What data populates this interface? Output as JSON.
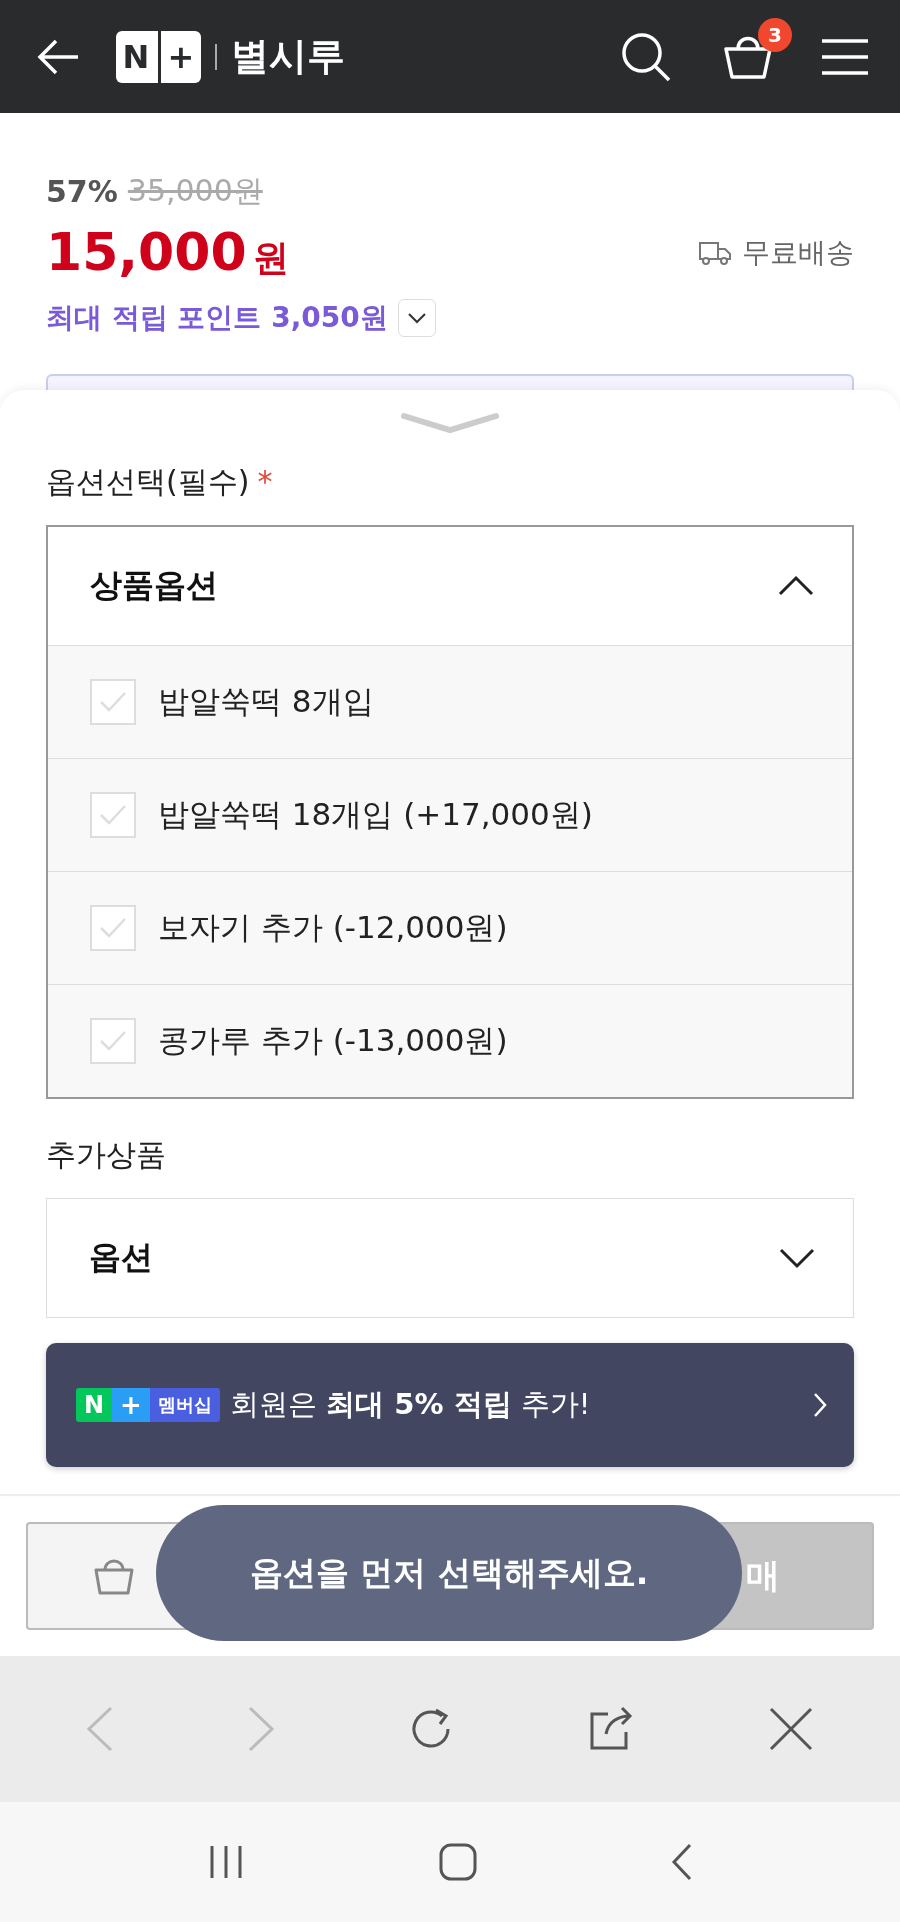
{
  "header": {
    "logo": {
      "n": "N",
      "plus": "+"
    },
    "store_name": "별시루",
    "cart_count": "3"
  },
  "price": {
    "discount": "57%",
    "original": "35,000원",
    "amount": "15,000",
    "currency": "원",
    "shipping": "무료배송",
    "points": "최대 적립 포인트 3,050원",
    "points_expanded": false
  },
  "option_sheet": {
    "label": "옵션선택(필수)",
    "required_mark": "*",
    "dropdown": {
      "title": "상품옵션",
      "expanded": true,
      "options": [
        {
          "label": "밥알쑥떡 8개입",
          "checked": false
        },
        {
          "label": "밥알쑥떡 18개입 (+17,000원)",
          "checked": false
        },
        {
          "label": "보자기 추가 (-12,000원)",
          "checked": false
        },
        {
          "label": "콩가루 추가 (-13,000원)",
          "checked": false
        }
      ]
    },
    "extra_label": "추가상품",
    "extra_dropdown": {
      "title": "옵션",
      "expanded": false
    }
  },
  "membership_banner": {
    "badge_n": "N",
    "badge_plus": "+",
    "badge_text": "멤버십",
    "message": "회원은 **최대 5% 적립** 추가!"
  },
  "buy_bar": {
    "buy_button": "매"
  },
  "toast": "옵션을 먼저 선택해주세요.",
  "browser_bar": {
    "back_disabled": true,
    "forward_disabled": true
  }
}
